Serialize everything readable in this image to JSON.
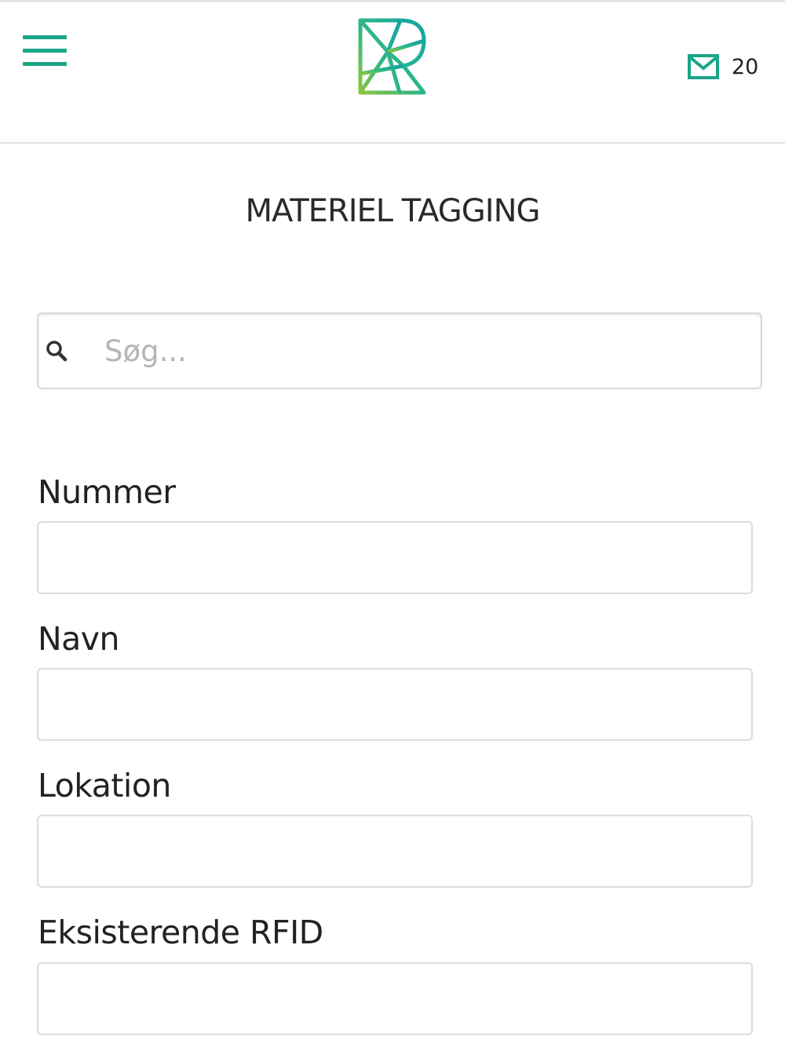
{
  "header": {
    "menu_icon": "hamburger-menu-icon",
    "logo_icon": "brand-logo-icon",
    "mail_icon": "envelope-icon",
    "message_count": "20"
  },
  "page": {
    "title": "MATERIEL TAGGING"
  },
  "search": {
    "icon": "search-icon",
    "placeholder": "Søg...",
    "value": ""
  },
  "form": {
    "fields": [
      {
        "label": "Nummer",
        "value": ""
      },
      {
        "label": "Navn",
        "value": ""
      },
      {
        "label": "Lokation",
        "value": ""
      },
      {
        "label": "Eksisterende RFID",
        "value": ""
      }
    ]
  },
  "colors": {
    "accent": "#1aa586",
    "accent_green": "#8cc63f",
    "text": "#222222",
    "border": "#dcdcdc"
  }
}
